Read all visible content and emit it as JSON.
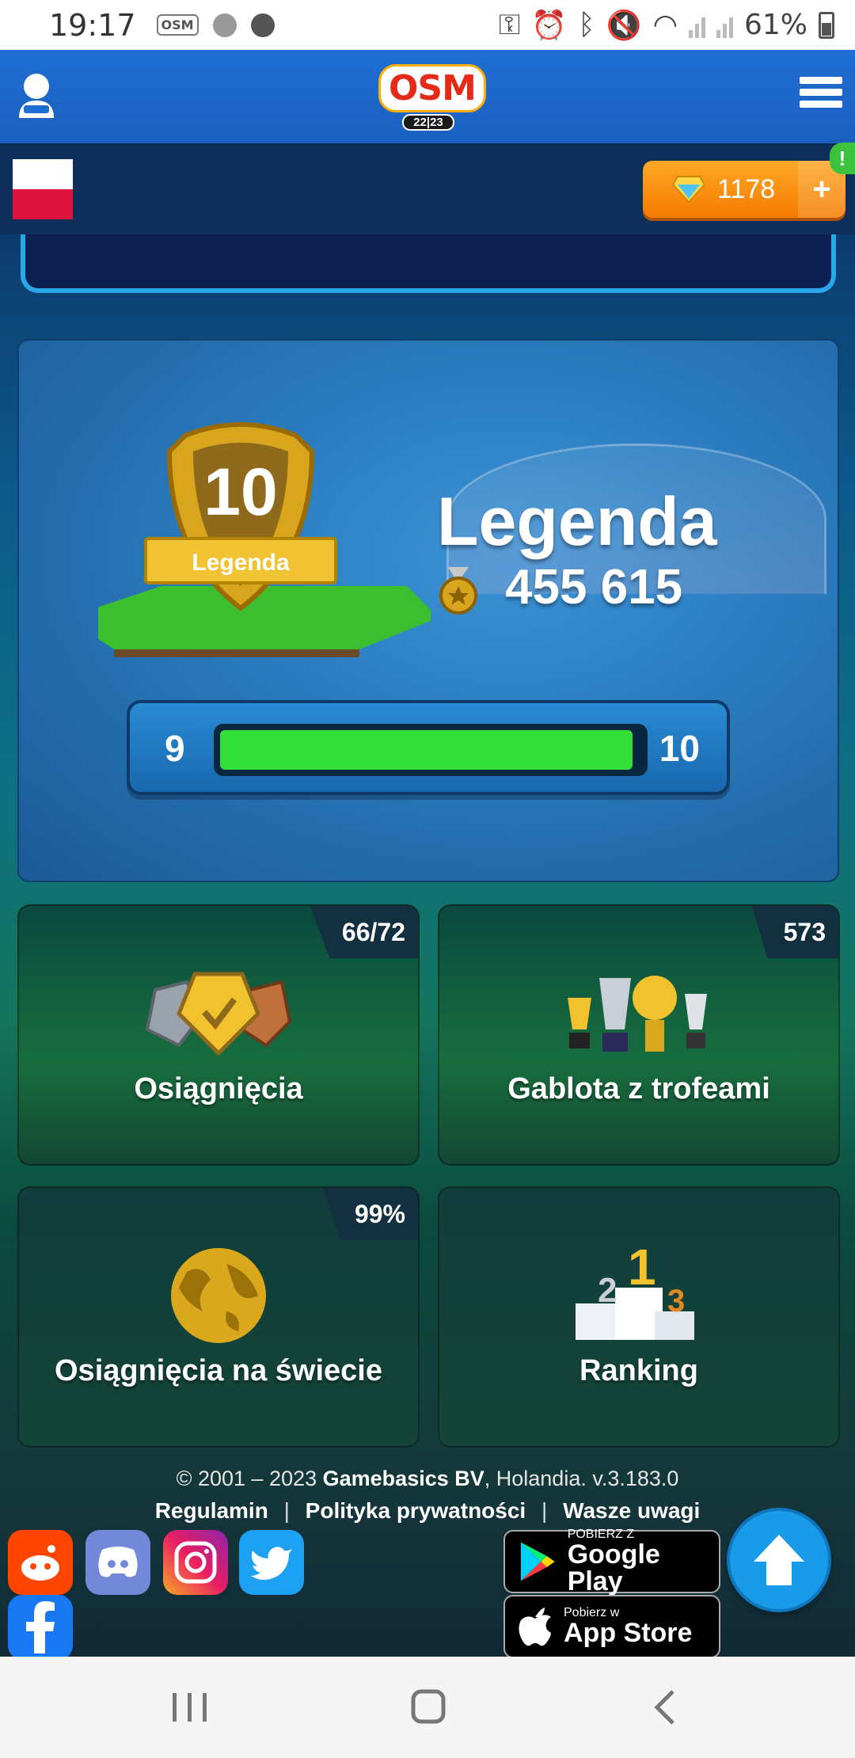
{
  "status_bar": {
    "time": "19:17",
    "battery": "61%"
  },
  "header": {
    "logo_text": "OSM",
    "logo_season": "22|23"
  },
  "subheader": {
    "coins": "1178",
    "add_label": "+",
    "alert": "!"
  },
  "level": {
    "badge_number": "10",
    "badge_label": "Legenda",
    "title": "Legenda",
    "points": "455 615",
    "progress_from": "9",
    "progress_to": "10",
    "progress_fraction": 0.98
  },
  "tiles": [
    {
      "label": "Osiągnięcia",
      "count": "66/72",
      "icon": "medals-icon"
    },
    {
      "label": "Gablota z trofeami",
      "count": "573",
      "icon": "trophies-icon"
    },
    {
      "label": "Osiągnięcia na świecie",
      "count": "99%",
      "icon": "globe-icon"
    },
    {
      "label": "Ranking",
      "count": "",
      "icon": "podium-icon"
    }
  ],
  "footer": {
    "copyright_prefix": "© 2001 – 2023",
    "company": "Gamebasics BV",
    "copyright_suffix": ", Holandia. v.3.183.0",
    "links": [
      "Regulamin",
      "Polityka prywatności",
      "Wasze uwagi"
    ],
    "separator": "|",
    "google_play_small": "POBIERZ Z",
    "google_play_big": "Google Play",
    "app_store_small": "Pobierz w",
    "app_store_big": "App Store"
  },
  "colors": {
    "appbar": "#1f6fd3",
    "coins": "#f57c00",
    "progress": "#33e03a"
  }
}
